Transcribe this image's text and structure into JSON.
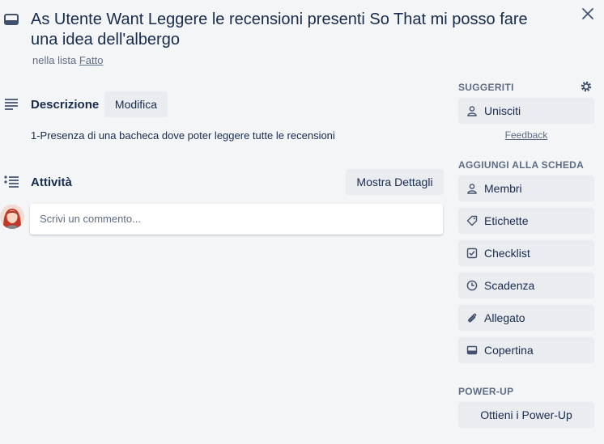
{
  "card": {
    "title": "As Utente Want Leggere le recensioni presenti So That mi posso fare una idea dell'albergo",
    "list_prefix": "nella lista ",
    "list_name": "Fatto"
  },
  "description": {
    "heading": "Descrizione",
    "edit_label": "Modifica",
    "text": "1-Presenza di una bacheca dove poter leggere tutte le recensioni"
  },
  "activity": {
    "heading": "Attività",
    "details_label": "Mostra Dettagli",
    "comment_placeholder": "Scrivi un commento..."
  },
  "sidebar": {
    "suggested_heading": "SUGGERITI",
    "join_label": "Unisciti",
    "feedback_label": "Feedback",
    "add_heading": "AGGIUNGI ALLA SCHEDA",
    "add_items": [
      {
        "label": "Membri",
        "icon": "person-icon"
      },
      {
        "label": "Etichette",
        "icon": "tag-icon"
      },
      {
        "label": "Checklist",
        "icon": "checklist-icon"
      },
      {
        "label": "Scadenza",
        "icon": "clock-icon"
      },
      {
        "label": "Allegato",
        "icon": "paperclip-icon"
      },
      {
        "label": "Copertina",
        "icon": "cover-icon"
      }
    ],
    "powerup_heading": "POWER-UP",
    "powerup_label": "Ottieni i Power-Up"
  },
  "colors": {
    "background": "#f4f5f7",
    "button": "#ebecf0",
    "text": "#172b4d",
    "muted": "#5e6c84"
  }
}
